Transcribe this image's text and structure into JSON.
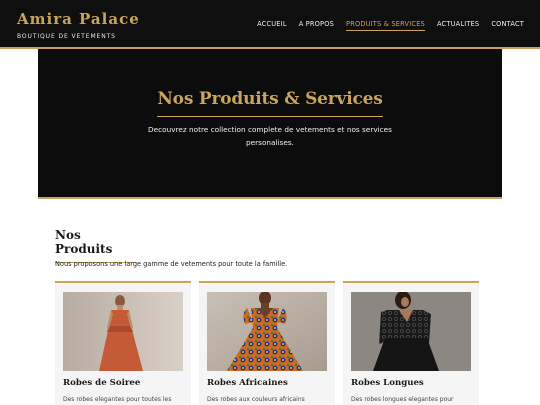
{
  "brand": {
    "name": "Amira Palace",
    "tagline": "BOUTIQUE DE VETEMENTS"
  },
  "nav": {
    "items": [
      {
        "label": "ACCUEIL",
        "active": false
      },
      {
        "label": "A PROPOS",
        "active": false
      },
      {
        "label": "PRODUITS & SERVICES",
        "active": true
      },
      {
        "label": "ACTUALITES",
        "active": false
      },
      {
        "label": "CONTACT",
        "active": false
      }
    ]
  },
  "hero": {
    "title": "Nos Produits & Services",
    "subtitle": "Decouvrez notre collection complete de vetements et nos services personalises."
  },
  "products": {
    "title": "Nos Produits",
    "intro": "Nous proposons une large gamme de vetements pour toute la famille.",
    "cards": [
      {
        "title": "Robes de Soiree",
        "desc": "Des robes elegantes pour toutes les"
      },
      {
        "title": "Robes Africaines",
        "desc": "Des robes aux couleurs africains"
      },
      {
        "title": "Robes Longues",
        "desc": "Des robes longues elegantes pour"
      }
    ]
  },
  "colors": {
    "accent": "#c9a45a",
    "header_bg": "#0f0f0f",
    "card_bg": "#f5f5f5"
  }
}
